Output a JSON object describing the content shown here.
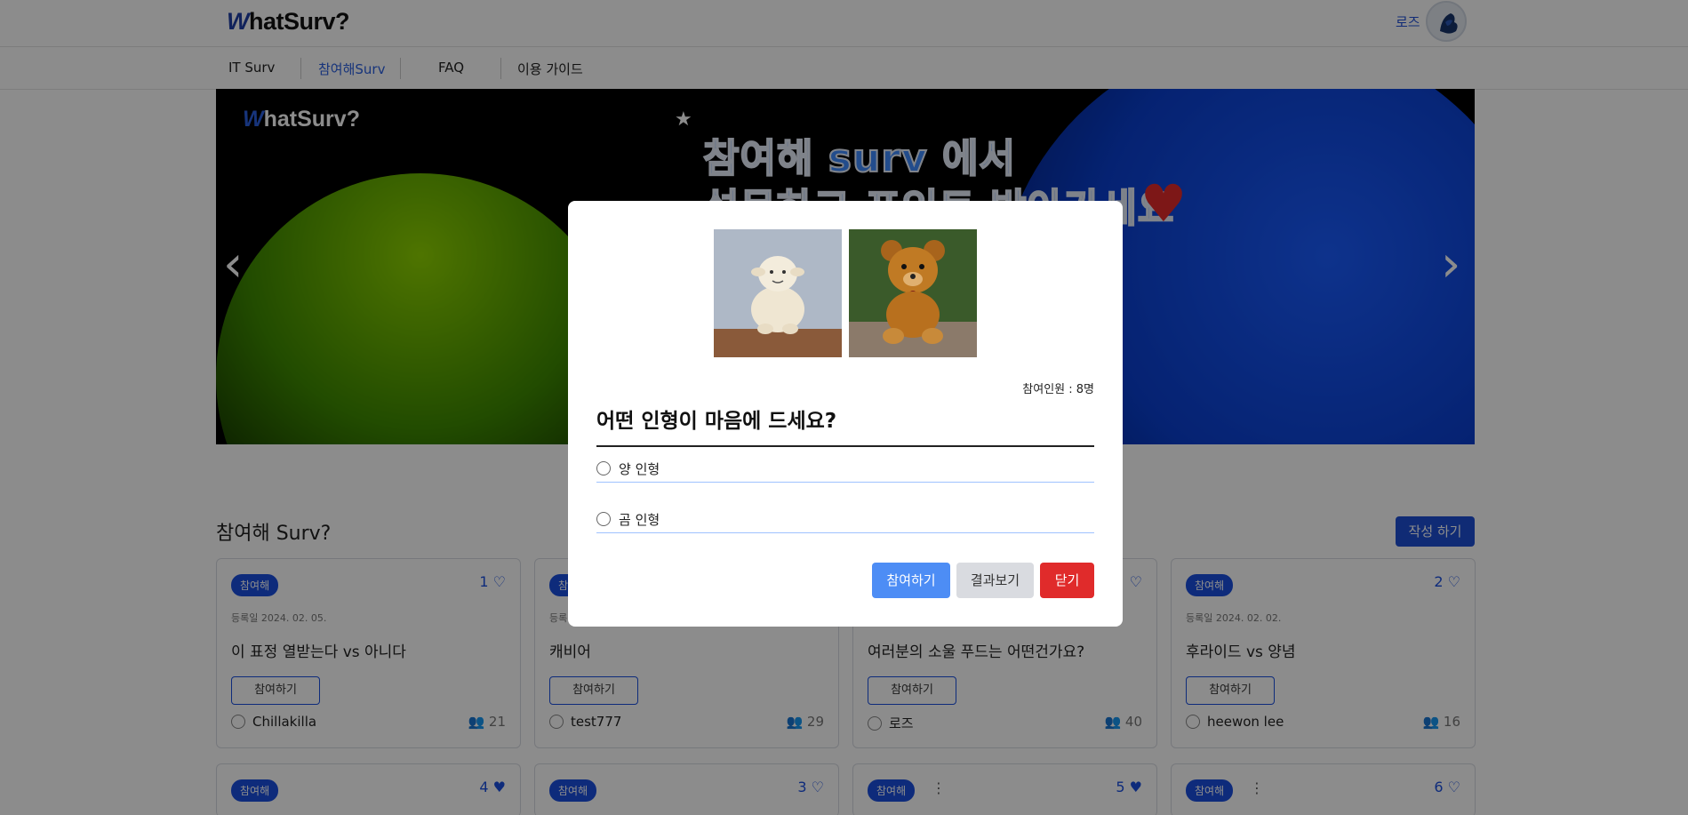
{
  "header": {
    "logo_w": "W",
    "logo_rest": "hatSurv?",
    "user_name": "로즈"
  },
  "nav": {
    "items": [
      "IT Surv",
      "참여해Surv",
      "FAQ",
      "이용 가이드"
    ],
    "active_index": 1
  },
  "banner": {
    "logo_w": "W",
    "logo_rest": "hatSurv?",
    "star": "★",
    "line1": "참여해 surv 에서",
    "line2": "설문하고 포인트 받아가세요",
    "heart": "♥",
    "prev": "‹",
    "next": "›"
  },
  "section": {
    "title": "참여해 Surv?",
    "write_button": "작성 하기"
  },
  "cards": [
    {
      "tag": "참여해",
      "likes": "1",
      "date": "등록일 2024. 02. 05.",
      "title": "이 표정 열받는다 vs 아니다",
      "join": "참여하기",
      "author": "Chillakilla",
      "count": "21"
    },
    {
      "tag": "참여해",
      "likes": "",
      "date": "등록일",
      "title": "캐비어",
      "join": "참여하기",
      "author": "test777",
      "count": "29"
    },
    {
      "tag": "참여해",
      "likes": "",
      "date": "",
      "title": "여러분의 소울 푸드는 어떤건가요?",
      "join": "참여하기",
      "author": "로즈",
      "count": "40"
    },
    {
      "tag": "참여해",
      "likes": "2",
      "date": "등록일 2024. 02. 02.",
      "title": "후라이드 vs 양념",
      "join": "참여하기",
      "author": "heewon lee",
      "count": "16"
    }
  ],
  "cards_row2": [
    {
      "tag": "참여해",
      "likes": "4"
    },
    {
      "tag": "참여해",
      "likes": "3"
    },
    {
      "tag": "참여해",
      "likes": "5",
      "kebab": "⋮"
    },
    {
      "tag": "참여해",
      "likes": "6",
      "kebab": "⋮"
    }
  ],
  "modal": {
    "participants": "참여인원 : 8명",
    "question": "어떤 인형이 마음에 드세요?",
    "options": [
      "양 인형",
      "곰 인형"
    ],
    "buttons": {
      "join": "참여하기",
      "result": "결과보기",
      "close": "닫기"
    }
  },
  "colors": {
    "brand": "#1e4fd6",
    "primary_button": "#4d8df5",
    "close_button": "#e02b2b",
    "secondary_button": "#d9dbe0"
  },
  "icons": [
    "heart-icon",
    "user-icon",
    "people-icon",
    "kebab-icon",
    "chevron-left-icon",
    "chevron-right-icon"
  ]
}
